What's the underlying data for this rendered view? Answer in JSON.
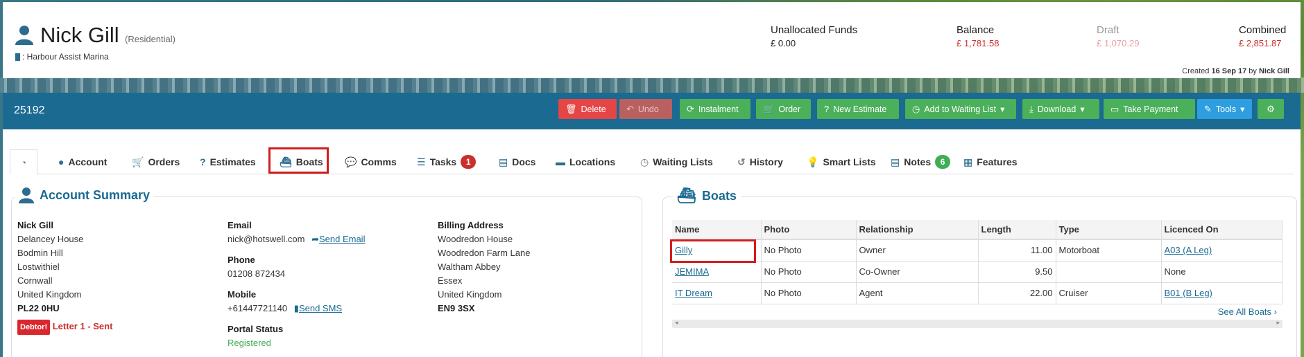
{
  "header": {
    "name": "Nick Gill",
    "type": "(Residential)",
    "marina": ": Harbour Assist Marina",
    "funds": [
      {
        "label": "Unallocated Funds",
        "value": "£ 0.00",
        "color": "#1e1e1e"
      },
      {
        "label": "Balance",
        "value": "£ 1,781.58",
        "color": "#c9302c"
      },
      {
        "label": "Draft",
        "value": "£ 1,070.29",
        "color": "#e8a0a0"
      },
      {
        "label": "Combined",
        "value": "£ 2,851.87",
        "color": "#c9302c"
      }
    ],
    "created_prefix": "Created",
    "created_date": "16 Sep 17",
    "created_by_prefix": "by",
    "created_by": "Nick Gill"
  },
  "toolbar": {
    "account_number": "25192",
    "buttons": {
      "delete": "Delete",
      "undo": "Undo",
      "instalment": "Instalment",
      "order": "Order",
      "new_estimate": "New Estimate",
      "waiting_list": "Add to Waiting List",
      "download": "Download",
      "take_payment": "Take Payment",
      "tools": "Tools"
    }
  },
  "tabs": {
    "account": "Account",
    "orders": "Orders",
    "estimates": "Estimates",
    "boats": "Boats",
    "comms": "Comms",
    "tasks": "Tasks",
    "tasks_count": "1",
    "docs": "Docs",
    "locations": "Locations",
    "waiting_lists": "Waiting Lists",
    "history": "History",
    "smart_lists": "Smart Lists",
    "notes": "Notes",
    "notes_count": "6",
    "features": "Features"
  },
  "account_summary": {
    "title": "Account Summary",
    "address": [
      "Nick Gill",
      "Delancey House",
      "Bodmin Hill",
      "Lostwithiel",
      "Cornwall",
      "United Kingdom",
      "PL22 0HU"
    ],
    "debtor_badge": "Debtor!",
    "letter_status": "Letter 1 - Sent",
    "email_label": "Email",
    "email": "nick@hotswell.com",
    "send_email": "Send Email",
    "phone_label": "Phone",
    "phone": "01208 872434",
    "mobile_label": "Mobile",
    "mobile": "+61447721140",
    "send_sms": "Send SMS",
    "portal_label": "Portal Status",
    "portal_value": "Registered",
    "billing_label": "Billing Address",
    "billing": [
      "Woodredon House",
      "Woodredon Farm Lane",
      "Waltham Abbey",
      "Essex",
      "United Kingdom",
      "EN9 3SX"
    ]
  },
  "boats": {
    "title": "Boats",
    "columns": [
      "Name",
      "Photo",
      "Relationship",
      "Length",
      "Type",
      "Licenced On"
    ],
    "rows": [
      [
        "Gilly",
        "No Photo",
        "Owner",
        "11.00",
        "Motorboat",
        "A03 (A Leg)"
      ],
      [
        "JEMIMA",
        "No Photo",
        "Co-Owner",
        "9.50",
        "",
        "None"
      ],
      [
        "IT Dream",
        "No Photo",
        "Agent",
        "22.00",
        "Cruiser",
        "B01 (B Leg)"
      ]
    ],
    "see_all": "See All Boats"
  }
}
